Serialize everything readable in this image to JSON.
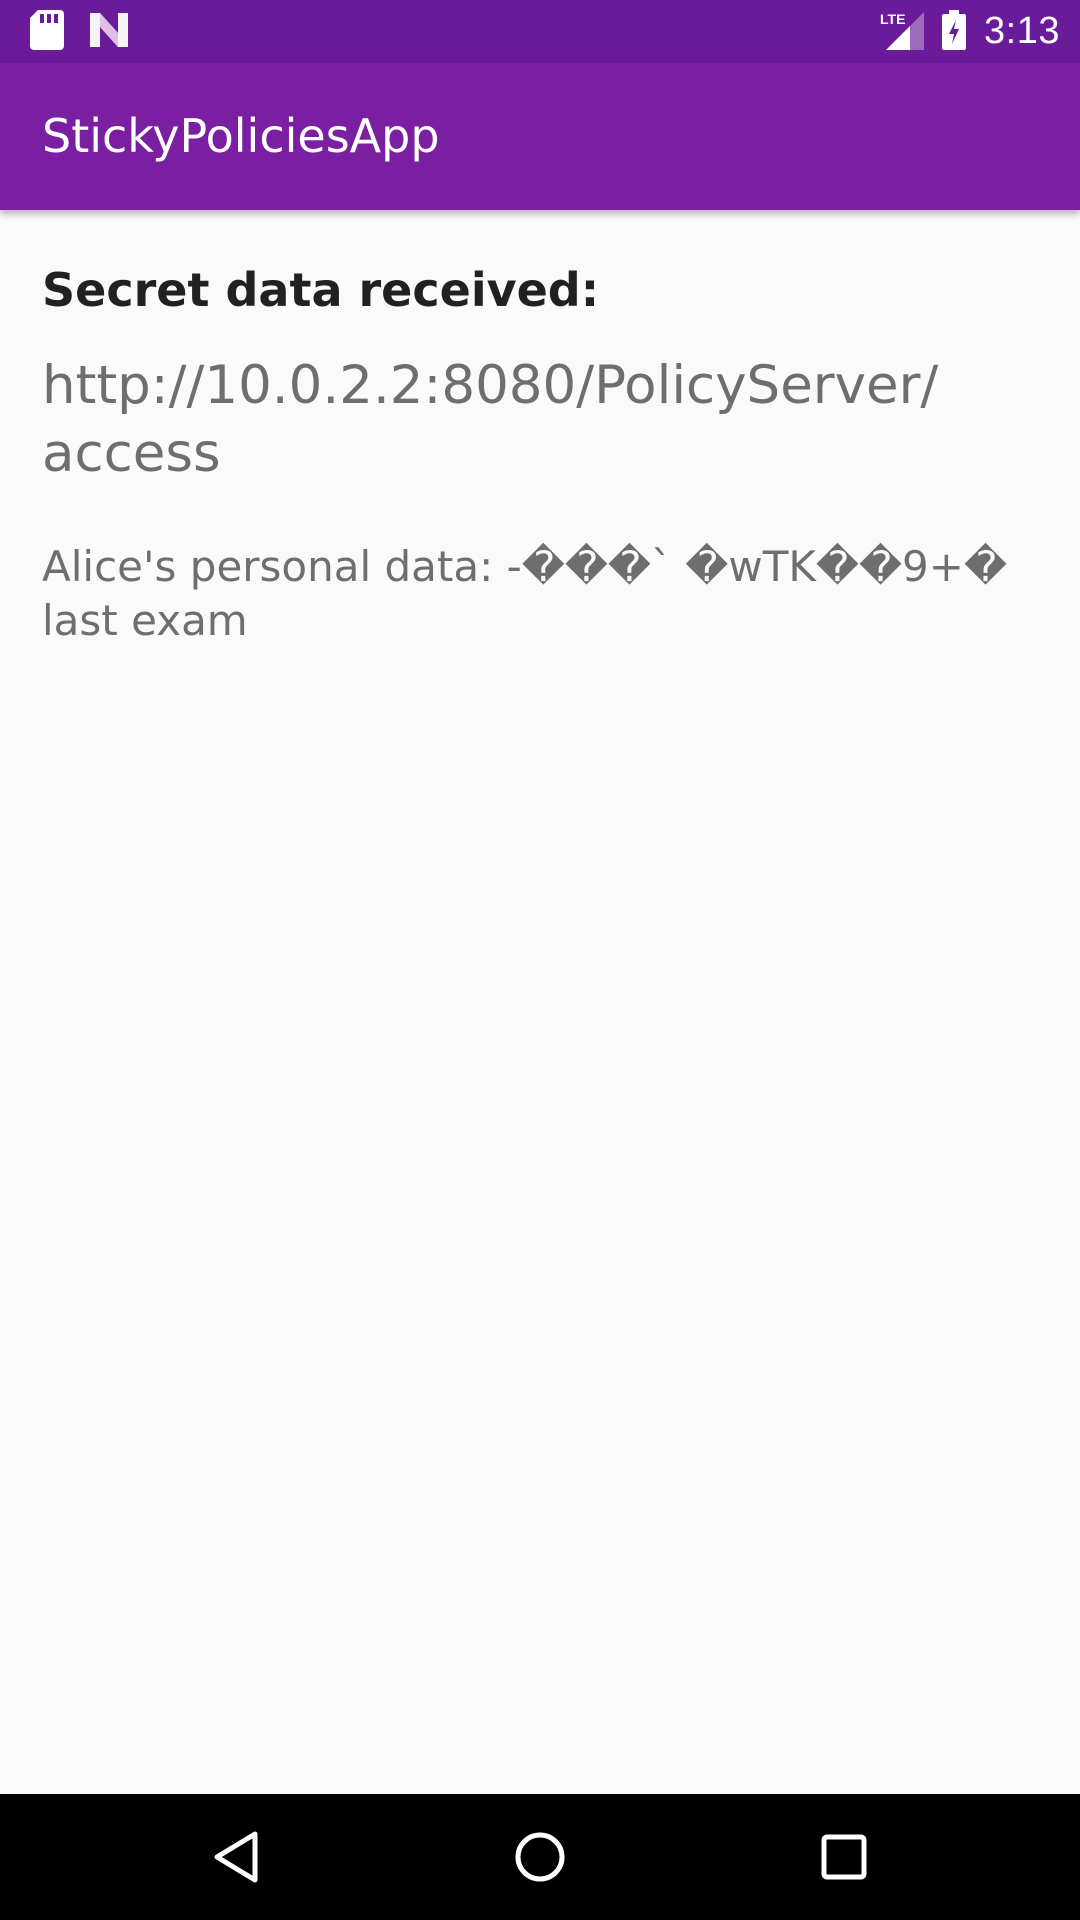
{
  "status_bar": {
    "time": "3:13",
    "network_label": "LTE",
    "icons": [
      "sd-card-icon",
      "n-notification-icon",
      "lte-signal-icon",
      "battery-charging-icon"
    ]
  },
  "app_bar": {
    "title": "StickyPoliciesApp"
  },
  "content": {
    "heading": "Secret data received:",
    "url": "http://10.0.2.2:8080/PolicyServer/access",
    "personal_data": "Alice's personal data: -���` �wTK��9+� last exam"
  },
  "nav_bar": {
    "icons": [
      "back-icon",
      "home-icon",
      "recents-icon"
    ]
  },
  "colors": {
    "status_bar": "#6A1B9A",
    "app_bar": "#7B1FA2",
    "background": "#FAFAFA",
    "heading_text": "#212121",
    "body_text": "#6E6E6E"
  }
}
